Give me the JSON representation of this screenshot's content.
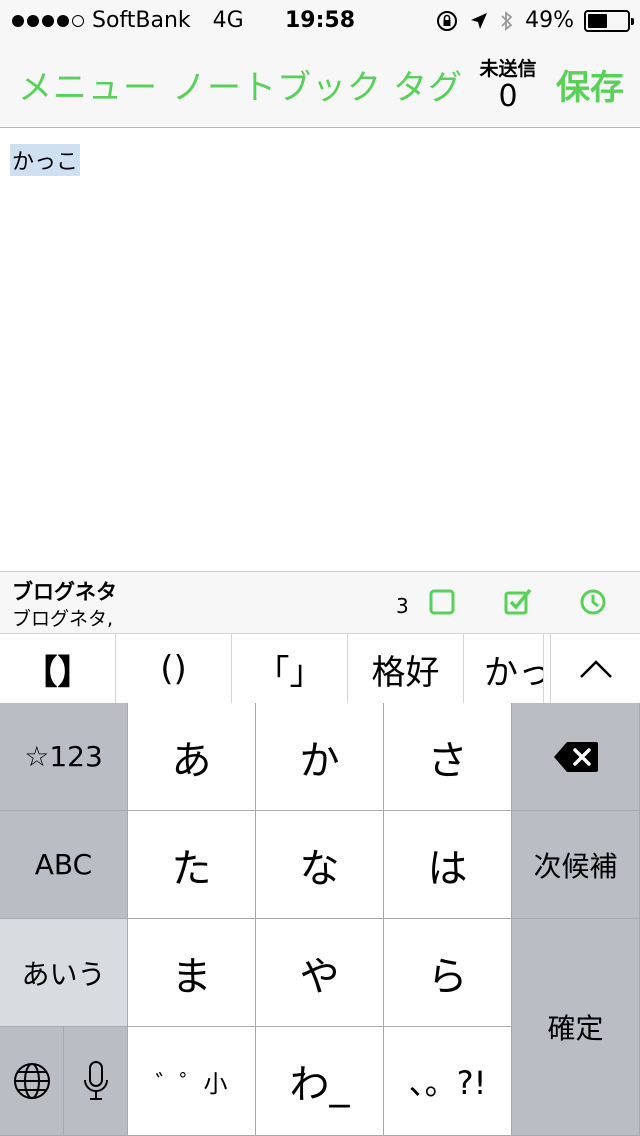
{
  "status_bar": {
    "carrier": "SoftBank",
    "network": "4G",
    "time": "19:58",
    "battery_percent_text": "49%",
    "battery_level": 0.49,
    "signal_dots_filled": 4,
    "signal_dots_total": 5
  },
  "nav": {
    "menu_label": "メニュー",
    "notebook_label": "ノートブック",
    "tag_label": "タグ",
    "unsent_label": "未送信",
    "unsent_count": "0",
    "save_label": "保存"
  },
  "editor": {
    "text": "かっこ"
  },
  "title_bar": {
    "title": "ブログネタ",
    "tags": "ブログネタ,",
    "count": "3"
  },
  "candidates": [
    "【】",
    "()",
    "「」",
    "格好",
    "かっ"
  ],
  "keyboard": {
    "symbols_key": "☆123",
    "abc_key": "ABC",
    "kana_mode_key": "あいう",
    "keys": [
      "あ",
      "か",
      "さ",
      "た",
      "な",
      "は",
      "ま",
      "や",
      "ら",
      "゛゜小",
      "わ_",
      "、。?!"
    ],
    "next_candidate_key": "次候補",
    "confirm_key": "確定"
  },
  "colors": {
    "accent_green": "#5ad05a",
    "keyboard_gray": "#babec4",
    "selection_blue": "#cfe0f2"
  },
  "icons": [
    "lock-rotation-icon",
    "location-arrow-icon",
    "bluetooth-icon",
    "battery-icon",
    "checkbox-empty-icon",
    "checkbox-checked-icon",
    "clock-icon",
    "chevron-up-icon",
    "delete-icon",
    "globe-icon",
    "microphone-icon"
  ]
}
